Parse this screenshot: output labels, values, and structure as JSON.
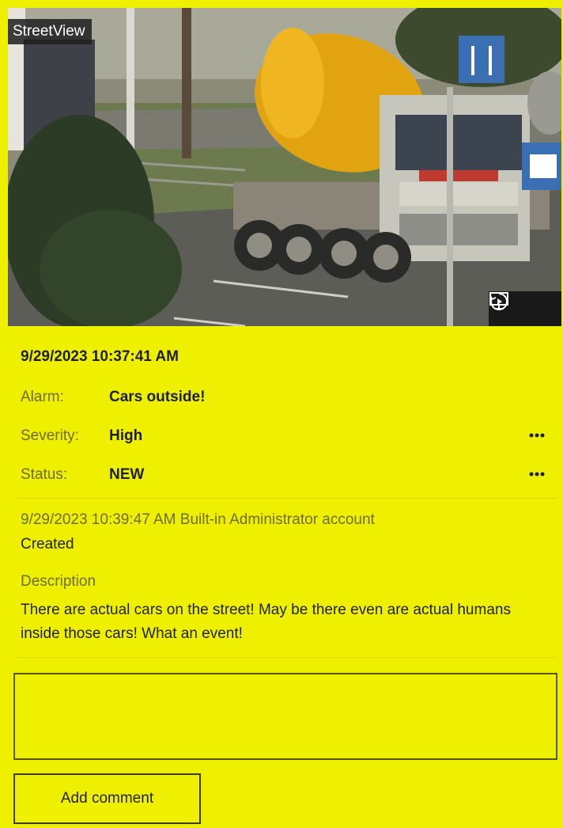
{
  "camera": {
    "name": "StreetView"
  },
  "alarm": {
    "timestamp": "9/29/2023 10:37:41 AM",
    "fields": [
      {
        "label": "Alarm:",
        "value": "Cars outside!"
      },
      {
        "label": "Severity:",
        "value": "High"
      },
      {
        "label": "Status:",
        "value": "NEW"
      }
    ]
  },
  "history": {
    "meta": "9/29/2023 10:39:47 AM  Built-in Administrator account",
    "action": "Created"
  },
  "description": {
    "label": "Description",
    "text": "There are actual cars on the street! May be there even are actual humans inside those cars! What an event!"
  },
  "comment": {
    "value": "",
    "button_label": "Add comment"
  },
  "colors": {
    "panel_background": "#eef000",
    "label_text": "#6d6a2a",
    "value_text": "#1e1e1e"
  },
  "icons": [
    "monitor-icon",
    "playback-icon",
    "more-options-icon"
  ]
}
